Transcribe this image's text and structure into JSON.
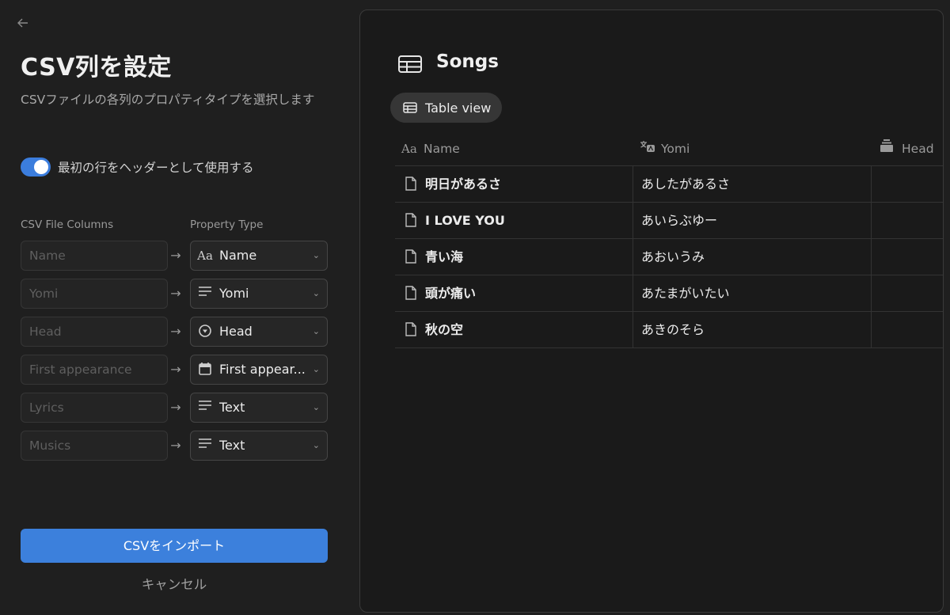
{
  "left_panel": {
    "back_icon": "arrow-left-icon",
    "title": "CSV列を設定",
    "subtitle": "CSVファイルの各列のプロパティタイプを選択します",
    "header_toggle": {
      "label": "最初の行をヘッダーとして使用する",
      "on": true
    },
    "columns_header": "CSV File Columns",
    "property_header": "Property Type",
    "mappings": [
      {
        "source": "Name",
        "type_icon": "title-aa-icon",
        "type": "Name"
      },
      {
        "source": "Yomi",
        "type_icon": "text-lines-icon",
        "type": "Yomi"
      },
      {
        "source": "Head",
        "type_icon": "select-circle-icon",
        "type": "Head"
      },
      {
        "source": "First appearance",
        "type_icon": "calendar-icon",
        "type": "First appear..."
      },
      {
        "source": "Lyrics",
        "type_icon": "text-lines-icon",
        "type": "Text"
      },
      {
        "source": "Musics",
        "type_icon": "text-lines-icon",
        "type": "Text"
      }
    ],
    "import_button": "CSVをインポート",
    "cancel_button": "キャンセル",
    "accent_color": "#3c80dc"
  },
  "preview": {
    "db_icon": "table-icon",
    "title": "Songs",
    "view_tab": {
      "icon": "table-icon",
      "label": "Table view"
    },
    "columns": [
      {
        "icon": "title-aa-icon",
        "label": "Name"
      },
      {
        "icon": "translate-icon",
        "label": "Yomi"
      },
      {
        "icon": "stack-icon",
        "label": "Head"
      }
    ],
    "rows": [
      {
        "name": "明日があるさ",
        "yomi": "あしたがあるさ"
      },
      {
        "name": "I LOVE YOU",
        "yomi": "あいらぶゆー"
      },
      {
        "name": "青い海",
        "yomi": "あおいうみ"
      },
      {
        "name": "頭が痛い",
        "yomi": "あたまがいたい"
      },
      {
        "name": "秋の空",
        "yomi": "あきのそら"
      }
    ]
  }
}
